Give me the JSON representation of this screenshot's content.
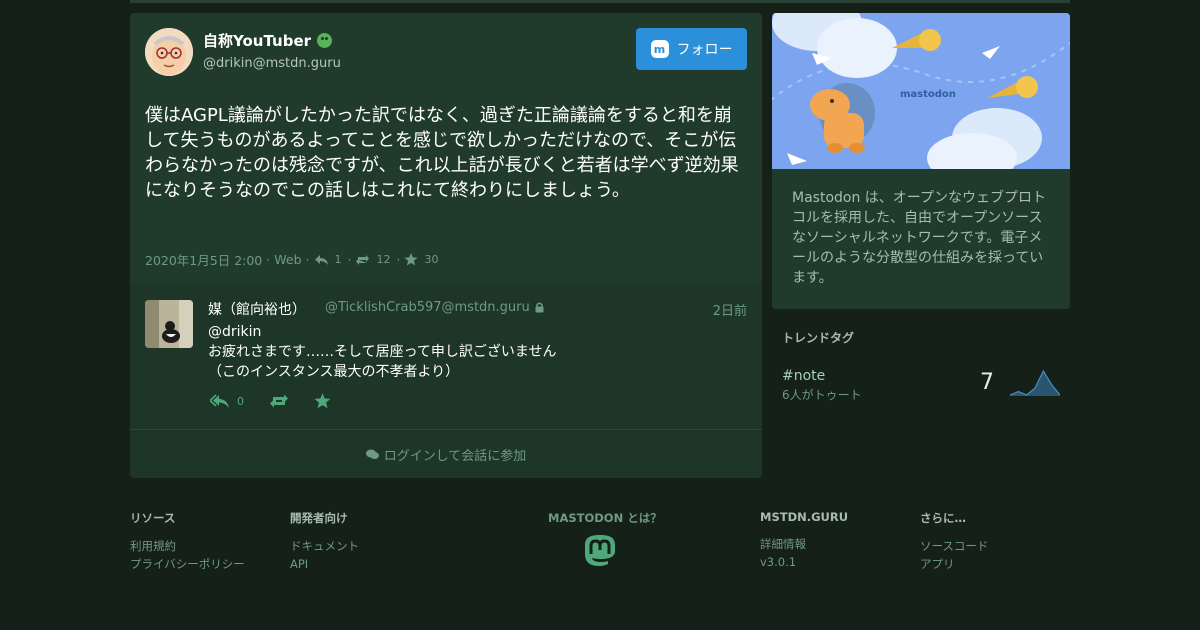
{
  "status": {
    "display_name": "自称YouTuber",
    "emoji_icon": "grimacing-face-emoji",
    "username": "@drikin@mstdn.guru",
    "follow_label": "フォロー",
    "content": "僕はAGPL議論がしたかった訳ではなく、過ぎた正論議論をすると和を崩して失うものがあるよってことを感じで欲しかっただけなので、そこが伝わらなかったのは残念ですが、これ以上話が長びくと若者は学べず逆効果になりそうなのでこの話しはこれにて終わりにしましょう。",
    "timestamp": "2020年1月5日 2:00",
    "application": "Web",
    "replies": "1",
    "boosts": "12",
    "favourites": "30"
  },
  "reply": {
    "display_name": "媒（館向裕也）",
    "handle": "@TicklishCrab597@mstdn.guru",
    "time": "2日前",
    "mention": "@drikin",
    "line1": "お疲れさまです……そして居座って申し訳ございません",
    "line2": "（このインスタンス最大の不孝者より）",
    "reply_count": "0"
  },
  "login_prompt": "ログインして会話に参加",
  "hero": {
    "brand": "mastodon"
  },
  "about_text": "Mastodon は、オープンなウェブプロトコルを採用した、自由でオープンソースなソーシャルネットワークです。電子メールのような分散型の仕組みを採っています。",
  "trends": {
    "title": "トレンドタグ",
    "items": [
      {
        "tag": "#note",
        "sub": "6人がトゥート",
        "count": "7",
        "history": [
          0,
          1,
          0,
          2,
          7,
          3,
          0
        ]
      }
    ]
  },
  "footer": {
    "resources": {
      "title": "リソース",
      "links": [
        "利用規約",
        "プライバシーポリシー"
      ]
    },
    "developers": {
      "title": "開発者向け",
      "links": [
        "ドキュメント",
        "API"
      ]
    },
    "about": {
      "title": "MASTODON とは？"
    },
    "instance": {
      "title": "MSTDN.GURU",
      "links": [
        "詳細情報",
        "v3.0.1"
      ]
    },
    "more": {
      "title": "さらに…",
      "links": [
        "ソースコード",
        "アプリ"
      ]
    }
  },
  "colors": {
    "background": "#152019",
    "card": "#203b2c",
    "accent": "#2b90d9",
    "muted": "#6e9a80",
    "action": "#4fa87a"
  }
}
